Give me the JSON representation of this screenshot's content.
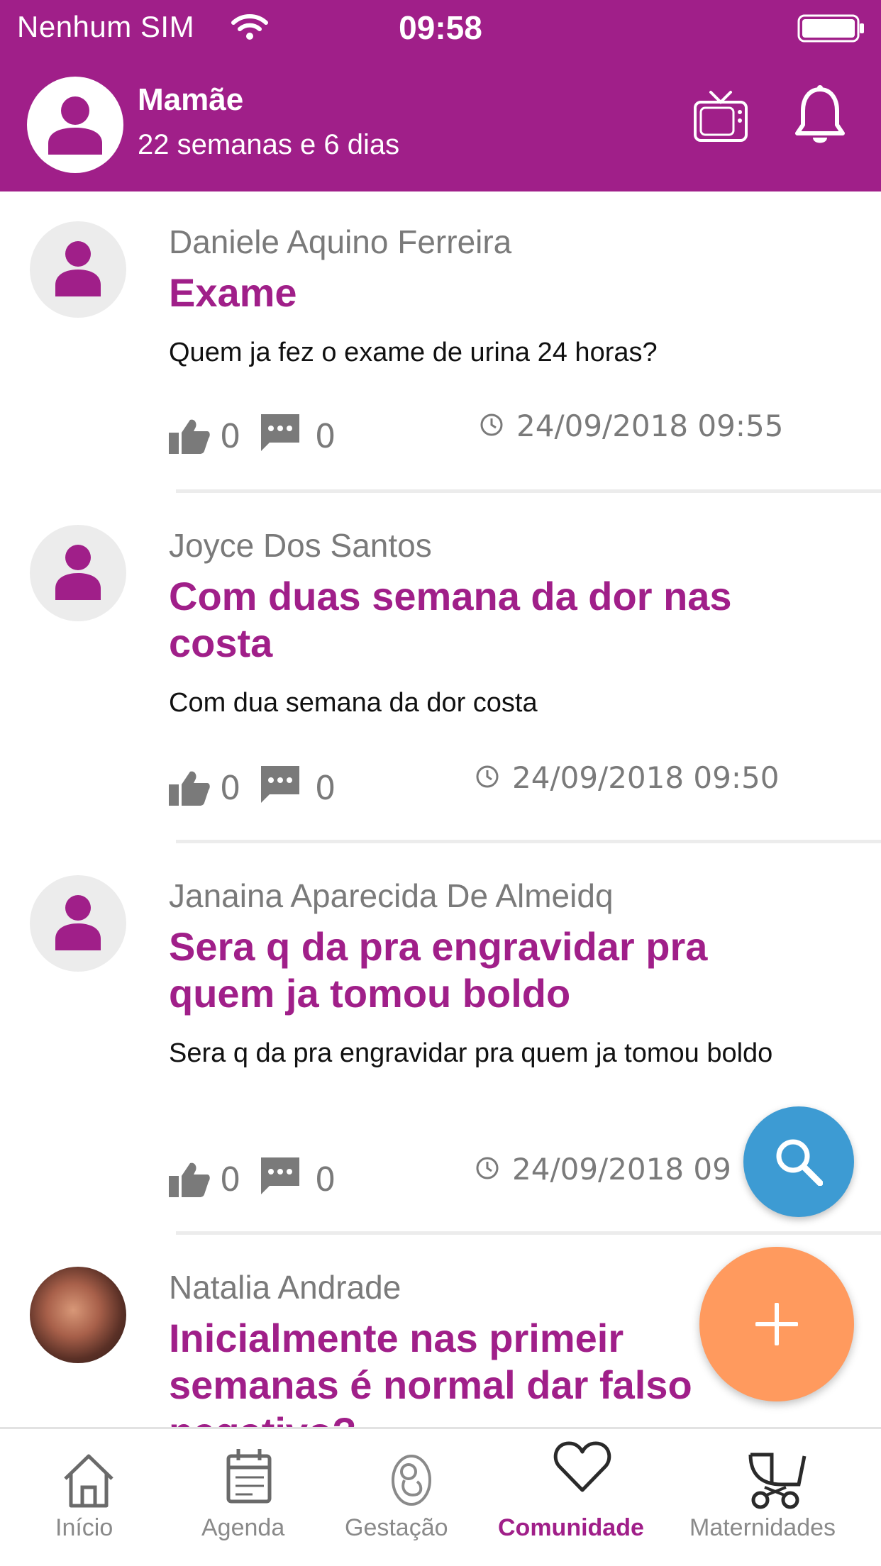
{
  "status_bar": {
    "carrier": "Nenhum SIM",
    "time": "09:58"
  },
  "header": {
    "name": "Mamãe",
    "subtitle": "22 semanas e 6 dias",
    "avatar_icon": "user-icon",
    "tv_icon": "tv-icon",
    "bell_icon": "bell-icon"
  },
  "posts": [
    {
      "author": "Daniele Aquino Ferreira",
      "title": "Exame",
      "body": "Quem ja fez o exame de urina 24 horas?",
      "likes": "0",
      "comments": "0",
      "date": "24/09/2018 09:55"
    },
    {
      "author": "Joyce Dos Santos",
      "title": "Com duas semana da dor nas costa",
      "body": "Com dua semana da dor costa",
      "likes": "0",
      "comments": "0",
      "date": "24/09/2018 09:50"
    },
    {
      "author": "Janaina Aparecida De Almeidq",
      "title": "Sera q da pra engravidar pra quem ja tomou boldo",
      "body": "Sera q da pra engravidar pra quem ja tomou boldo",
      "likes": "0",
      "comments": "0",
      "date": "24/09/2018 09"
    },
    {
      "author": "Natalia Andrade",
      "title": "Inicialmente nas primeir semanas é normal dar falso negativo?",
      "body": "",
      "likes": "",
      "comments": "",
      "date": ""
    }
  ],
  "fab": {
    "search_icon": "search-icon",
    "add_icon": "plus-icon"
  },
  "tabs": [
    {
      "label": "Início",
      "icon": "home-icon",
      "active": false
    },
    {
      "label": "Agenda",
      "icon": "calendar-icon",
      "active": false
    },
    {
      "label": "Gestação",
      "icon": "baby-icon",
      "active": false
    },
    {
      "label": "Comunidade",
      "icon": "heart-icon",
      "active": true
    },
    {
      "label": "Maternidades",
      "icon": "stroller-icon",
      "active": false
    }
  ],
  "colors": {
    "brand": "#a01f89",
    "search_fab": "#3d9bd3",
    "add_fab": "#ff9a5e",
    "muted_text": "#7a7a7a"
  }
}
